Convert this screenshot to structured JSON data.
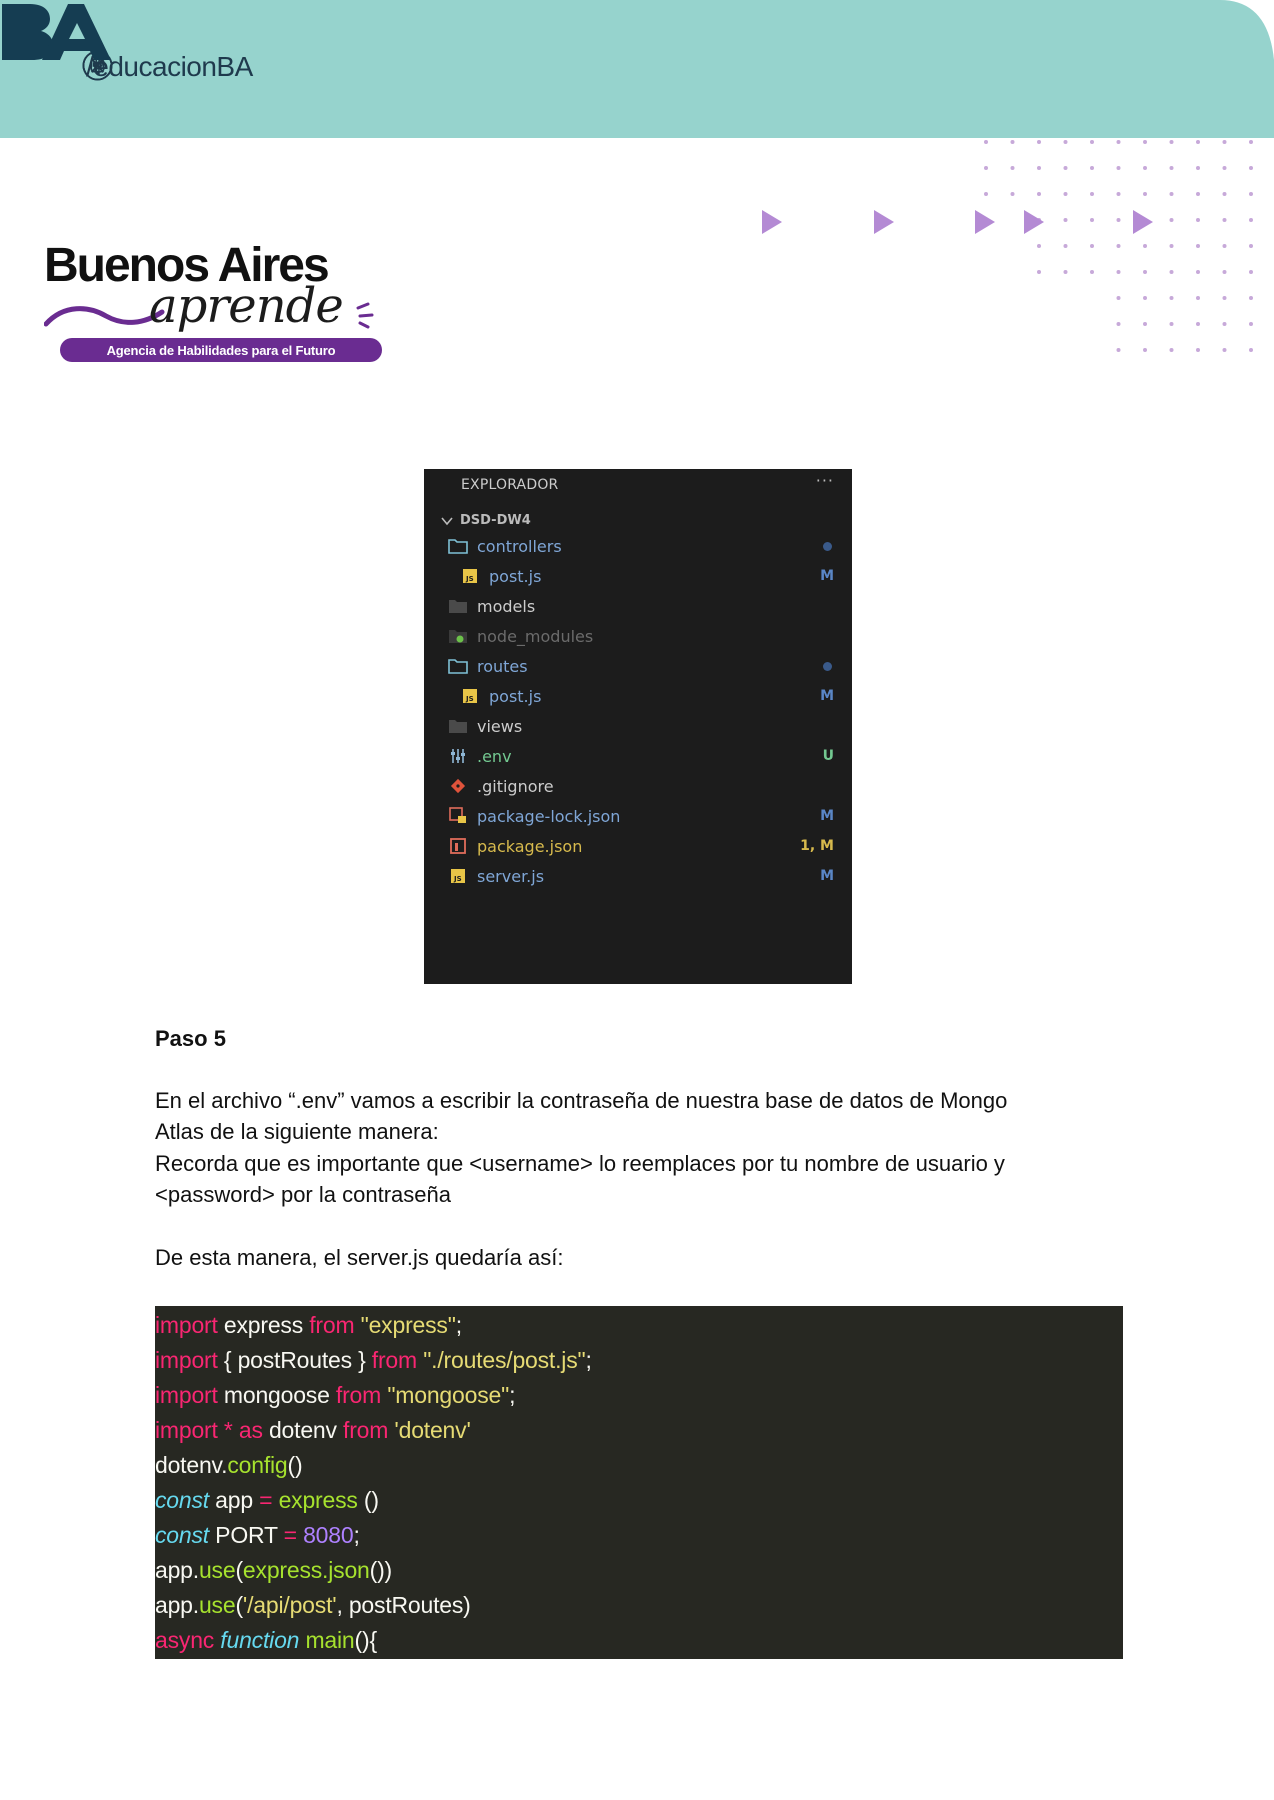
{
  "header": {
    "social_handle": "/educacionBA",
    "icons": [
      "instagram-icon",
      "x-icon",
      "facebook-icon"
    ],
    "logo_text": "BA",
    "band_color": "#96d3cd"
  },
  "brand": {
    "title": "Buenos Aires",
    "script": "aprende",
    "tagline": "Agencia de Habilidades para el Futuro"
  },
  "explorer": {
    "title": "EXPLORADOR",
    "more": "···",
    "project": "DSD-DW4",
    "items": [
      {
        "label": "controllers",
        "icon": "folder-open-icon",
        "status": "dot",
        "color": "#7fa6d6"
      },
      {
        "label": "post.js",
        "icon": "js-file-icon",
        "status": "M",
        "color": "#7fa6d6"
      },
      {
        "label": "models",
        "icon": "folder-icon",
        "status": "",
        "color": "#cccccc"
      },
      {
        "label": "node_modules",
        "icon": "folder-node-icon",
        "status": "",
        "color": "#6b6b6b"
      },
      {
        "label": "routes",
        "icon": "folder-open-icon",
        "status": "dot",
        "color": "#7fa6d6"
      },
      {
        "label": "post.js",
        "icon": "js-file-icon",
        "status": "M",
        "color": "#7fa6d6"
      },
      {
        "label": "views",
        "icon": "folder-icon",
        "status": "",
        "color": "#cccccc"
      },
      {
        "label": ".env",
        "icon": "env-settings-icon",
        "status": "U",
        "color": "#73c991"
      },
      {
        "label": ".gitignore",
        "icon": "git-icon",
        "status": "",
        "color": "#cccccc"
      },
      {
        "label": "package-lock.json",
        "icon": "lock-json-icon",
        "status": "M",
        "color": "#7fa6d6"
      },
      {
        "label": "package.json",
        "icon": "npm-json-icon",
        "status": "1, M",
        "color": "#d7ba4d"
      },
      {
        "label": "server.js",
        "icon": "js-file-icon",
        "status": "M",
        "color": "#7fa6d6"
      }
    ]
  },
  "content": {
    "step_title": "Paso 5",
    "para1_line1": "En el archivo “.env” vamos a escribir la contraseña de nuestra base de datos de Mongo",
    "para1_line2": "Atlas de la siguiente manera:",
    "para2_line1": "Recorda que es importante que <username> lo reemplaces por tu nombre de usuario y",
    "para2_line2": "<password> por la contraseña",
    "para3": "De esta manera,  el server.js quedaría así:"
  },
  "code": {
    "lines": [
      [
        {
          "t": "import",
          "c": "kw"
        },
        {
          "t": " express ",
          "c": ""
        },
        {
          "t": "from",
          "c": "kw"
        },
        {
          "t": " ",
          "c": ""
        },
        {
          "t": "\"express\"",
          "c": "str"
        },
        {
          "t": ";",
          "c": ""
        }
      ],
      [
        {
          "t": "import",
          "c": "kw"
        },
        {
          "t": " { postRoutes } ",
          "c": ""
        },
        {
          "t": "from",
          "c": "kw"
        },
        {
          "t": " ",
          "c": ""
        },
        {
          "t": "\"./routes/post.js\"",
          "c": "str"
        },
        {
          "t": ";",
          "c": ""
        }
      ],
      [
        {
          "t": "import",
          "c": "kw"
        },
        {
          "t": " mongoose ",
          "c": ""
        },
        {
          "t": "from",
          "c": "kw"
        },
        {
          "t": " ",
          "c": ""
        },
        {
          "t": "\"mongoose\"",
          "c": "str"
        },
        {
          "t": ";",
          "c": ""
        }
      ],
      [
        {
          "t": "import",
          "c": "kw"
        },
        {
          "t": " ",
          "c": ""
        },
        {
          "t": "* as",
          "c": "kw"
        },
        {
          "t": " dotenv ",
          "c": ""
        },
        {
          "t": "from",
          "c": "kw"
        },
        {
          "t": " ",
          "c": ""
        },
        {
          "t": "'dotenv'",
          "c": "str"
        }
      ],
      [
        {
          "t": "dotenv.",
          "c": ""
        },
        {
          "t": "config",
          "c": "fn"
        },
        {
          "t": "()",
          "c": ""
        }
      ],
      [
        {
          "t": "const",
          "c": "st"
        },
        {
          "t": " app ",
          "c": ""
        },
        {
          "t": "=",
          "c": "kw"
        },
        {
          "t": " ",
          "c": ""
        },
        {
          "t": "express",
          "c": "fn"
        },
        {
          "t": " ()",
          "c": ""
        }
      ],
      [
        {
          "t": "const",
          "c": "st"
        },
        {
          "t": " PORT ",
          "c": ""
        },
        {
          "t": "=",
          "c": "kw"
        },
        {
          "t": " ",
          "c": ""
        },
        {
          "t": "8080",
          "c": "num"
        },
        {
          "t": ";",
          "c": ""
        }
      ],
      [
        {
          "t": "app.",
          "c": ""
        },
        {
          "t": "use",
          "c": "fn"
        },
        {
          "t": "(",
          "c": ""
        },
        {
          "t": "express.json",
          "c": "fn"
        },
        {
          "t": "())",
          "c": ""
        }
      ],
      [
        {
          "t": "app.",
          "c": ""
        },
        {
          "t": "use",
          "c": "fn"
        },
        {
          "t": "(",
          "c": ""
        },
        {
          "t": "'/api/post'",
          "c": "str"
        },
        {
          "t": ", postRoutes)",
          "c": ""
        }
      ],
      [
        {
          "t": "async",
          "c": "kw"
        },
        {
          "t": " ",
          "c": ""
        },
        {
          "t": "function",
          "c": "st"
        },
        {
          "t": " ",
          "c": ""
        },
        {
          "t": "main",
          "c": "fn"
        },
        {
          "t": "(){",
          "c": ""
        }
      ]
    ]
  }
}
